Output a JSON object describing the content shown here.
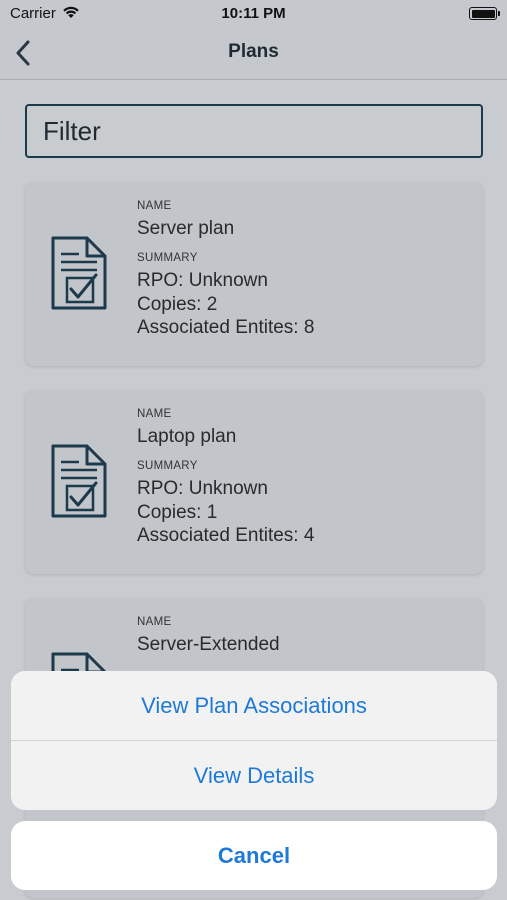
{
  "status_bar": {
    "carrier": "Carrier",
    "time": "10:11 PM"
  },
  "nav": {
    "title": "Plans"
  },
  "filter": {
    "placeholder": "Filter",
    "value": ""
  },
  "labels": {
    "name": "NAME",
    "summary": "SUMMARY"
  },
  "plans": [
    {
      "name": "Server plan",
      "summary": [
        "RPO: Unknown",
        "Copies: 2",
        "Associated Entites: 8"
      ]
    },
    {
      "name": "Laptop plan",
      "summary": [
        "RPO: Unknown",
        "Copies: 1",
        "Associated Entites: 4"
      ]
    },
    {
      "name": "Server-Extended",
      "summary": []
    }
  ],
  "action_sheet": {
    "actions": [
      "View Plan Associations",
      "View Details"
    ],
    "cancel": "Cancel"
  },
  "colors": {
    "accent": "#1e7ad6",
    "icon_stroke": "#1c3a4c"
  }
}
